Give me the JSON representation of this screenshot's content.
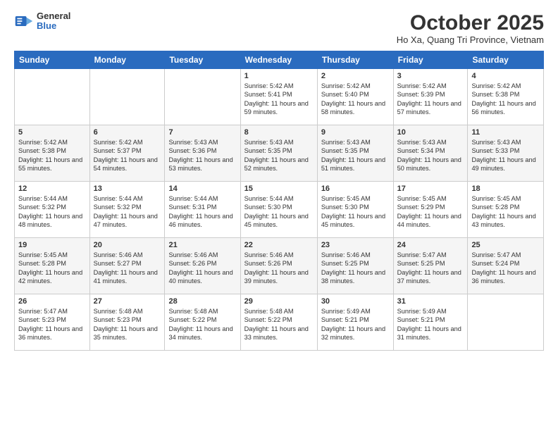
{
  "logo": {
    "general": "General",
    "blue": "Blue"
  },
  "title": "October 2025",
  "location": "Ho Xa, Quang Tri Province, Vietnam",
  "headers": [
    "Sunday",
    "Monday",
    "Tuesday",
    "Wednesday",
    "Thursday",
    "Friday",
    "Saturday"
  ],
  "weeks": [
    [
      {
        "day": "",
        "info": ""
      },
      {
        "day": "",
        "info": ""
      },
      {
        "day": "",
        "info": ""
      },
      {
        "day": "1",
        "info": "Sunrise: 5:42 AM\nSunset: 5:41 PM\nDaylight: 11 hours\nand 59 minutes."
      },
      {
        "day": "2",
        "info": "Sunrise: 5:42 AM\nSunset: 5:40 PM\nDaylight: 11 hours\nand 58 minutes."
      },
      {
        "day": "3",
        "info": "Sunrise: 5:42 AM\nSunset: 5:39 PM\nDaylight: 11 hours\nand 57 minutes."
      },
      {
        "day": "4",
        "info": "Sunrise: 5:42 AM\nSunset: 5:38 PM\nDaylight: 11 hours\nand 56 minutes."
      }
    ],
    [
      {
        "day": "5",
        "info": "Sunrise: 5:42 AM\nSunset: 5:38 PM\nDaylight: 11 hours\nand 55 minutes."
      },
      {
        "day": "6",
        "info": "Sunrise: 5:42 AM\nSunset: 5:37 PM\nDaylight: 11 hours\nand 54 minutes."
      },
      {
        "day": "7",
        "info": "Sunrise: 5:43 AM\nSunset: 5:36 PM\nDaylight: 11 hours\nand 53 minutes."
      },
      {
        "day": "8",
        "info": "Sunrise: 5:43 AM\nSunset: 5:35 PM\nDaylight: 11 hours\nand 52 minutes."
      },
      {
        "day": "9",
        "info": "Sunrise: 5:43 AM\nSunset: 5:35 PM\nDaylight: 11 hours\nand 51 minutes."
      },
      {
        "day": "10",
        "info": "Sunrise: 5:43 AM\nSunset: 5:34 PM\nDaylight: 11 hours\nand 50 minutes."
      },
      {
        "day": "11",
        "info": "Sunrise: 5:43 AM\nSunset: 5:33 PM\nDaylight: 11 hours\nand 49 minutes."
      }
    ],
    [
      {
        "day": "12",
        "info": "Sunrise: 5:44 AM\nSunset: 5:32 PM\nDaylight: 11 hours\nand 48 minutes."
      },
      {
        "day": "13",
        "info": "Sunrise: 5:44 AM\nSunset: 5:32 PM\nDaylight: 11 hours\nand 47 minutes."
      },
      {
        "day": "14",
        "info": "Sunrise: 5:44 AM\nSunset: 5:31 PM\nDaylight: 11 hours\nand 46 minutes."
      },
      {
        "day": "15",
        "info": "Sunrise: 5:44 AM\nSunset: 5:30 PM\nDaylight: 11 hours\nand 45 minutes."
      },
      {
        "day": "16",
        "info": "Sunrise: 5:45 AM\nSunset: 5:30 PM\nDaylight: 11 hours\nand 45 minutes."
      },
      {
        "day": "17",
        "info": "Sunrise: 5:45 AM\nSunset: 5:29 PM\nDaylight: 11 hours\nand 44 minutes."
      },
      {
        "day": "18",
        "info": "Sunrise: 5:45 AM\nSunset: 5:28 PM\nDaylight: 11 hours\nand 43 minutes."
      }
    ],
    [
      {
        "day": "19",
        "info": "Sunrise: 5:45 AM\nSunset: 5:28 PM\nDaylight: 11 hours\nand 42 minutes."
      },
      {
        "day": "20",
        "info": "Sunrise: 5:46 AM\nSunset: 5:27 PM\nDaylight: 11 hours\nand 41 minutes."
      },
      {
        "day": "21",
        "info": "Sunrise: 5:46 AM\nSunset: 5:26 PM\nDaylight: 11 hours\nand 40 minutes."
      },
      {
        "day": "22",
        "info": "Sunrise: 5:46 AM\nSunset: 5:26 PM\nDaylight: 11 hours\nand 39 minutes."
      },
      {
        "day": "23",
        "info": "Sunrise: 5:46 AM\nSunset: 5:25 PM\nDaylight: 11 hours\nand 38 minutes."
      },
      {
        "day": "24",
        "info": "Sunrise: 5:47 AM\nSunset: 5:25 PM\nDaylight: 11 hours\nand 37 minutes."
      },
      {
        "day": "25",
        "info": "Sunrise: 5:47 AM\nSunset: 5:24 PM\nDaylight: 11 hours\nand 36 minutes."
      }
    ],
    [
      {
        "day": "26",
        "info": "Sunrise: 5:47 AM\nSunset: 5:23 PM\nDaylight: 11 hours\nand 36 minutes."
      },
      {
        "day": "27",
        "info": "Sunrise: 5:48 AM\nSunset: 5:23 PM\nDaylight: 11 hours\nand 35 minutes."
      },
      {
        "day": "28",
        "info": "Sunrise: 5:48 AM\nSunset: 5:22 PM\nDaylight: 11 hours\nand 34 minutes."
      },
      {
        "day": "29",
        "info": "Sunrise: 5:48 AM\nSunset: 5:22 PM\nDaylight: 11 hours\nand 33 minutes."
      },
      {
        "day": "30",
        "info": "Sunrise: 5:49 AM\nSunset: 5:21 PM\nDaylight: 11 hours\nand 32 minutes."
      },
      {
        "day": "31",
        "info": "Sunrise: 5:49 AM\nSunset: 5:21 PM\nDaylight: 11 hours\nand 31 minutes."
      },
      {
        "day": "",
        "info": ""
      }
    ]
  ]
}
